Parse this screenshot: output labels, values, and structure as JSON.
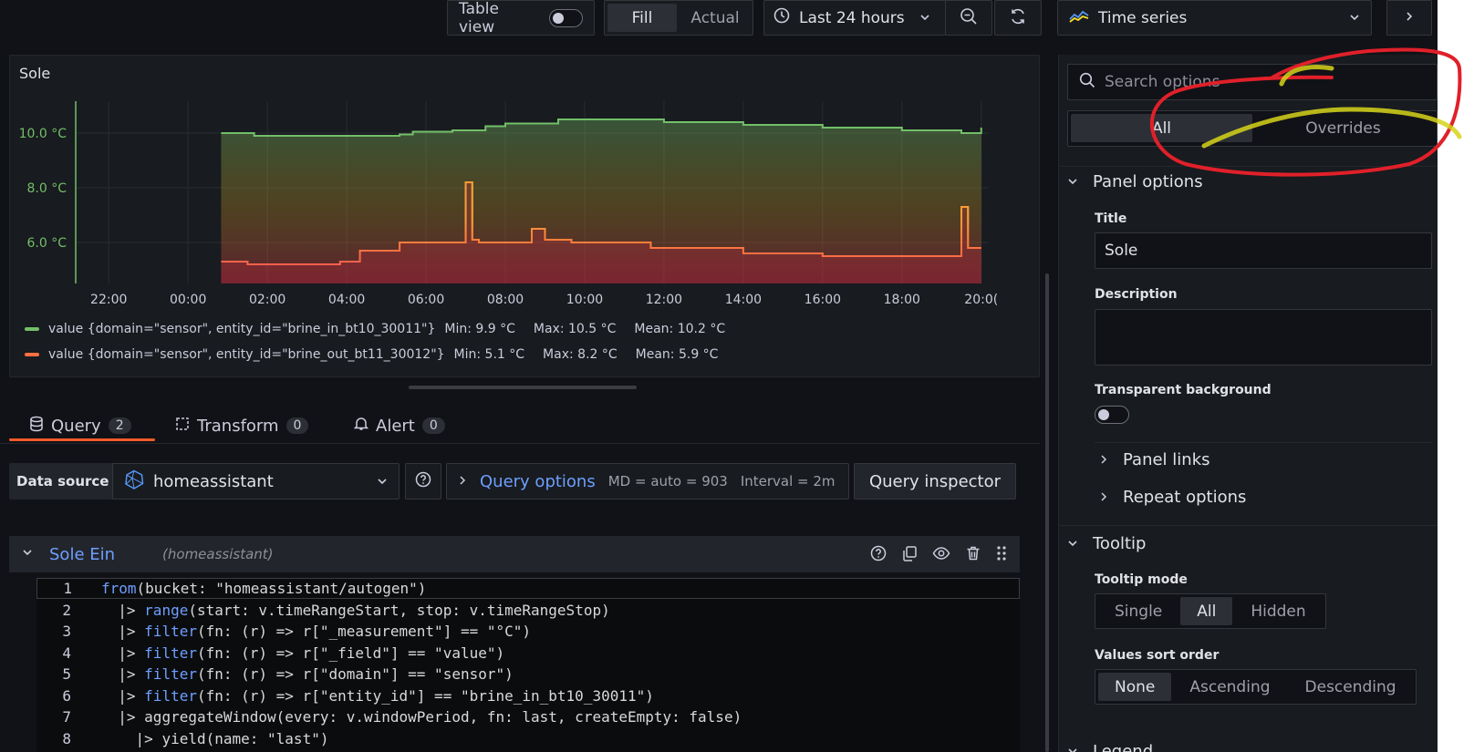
{
  "toolbar": {
    "table_view_label": "Table view",
    "fill_label": "Fill",
    "actual_label": "Actual",
    "time_range": "Last 24 hours",
    "visualization": "Time series"
  },
  "panel": {
    "title": "Sole",
    "y_ticks": [
      "10.0 °C",
      "8.0 °C",
      "6.0 °C"
    ],
    "x_ticks": [
      "22:00",
      "00:00",
      "02:00",
      "04:00",
      "06:00",
      "08:00",
      "10:00",
      "12:00",
      "14:00",
      "16:00",
      "18:00",
      "20:0("
    ]
  },
  "chart_data": {
    "type": "line",
    "unit": "°C",
    "ylim": [
      4.5,
      11.0
    ],
    "series": [
      {
        "name": "value {domain=\"sensor\", entity_id=\"brine_in_bt10_30011\"}",
        "color": "#73bf69",
        "min": "Min: 9.9 °C",
        "max": "Max: 10.5 °C",
        "mean": "Mean: 10.2 °C",
        "x": [
          "00:50",
          "01:40",
          "05:20",
          "05:40",
          "06:40",
          "07:30",
          "08:00",
          "09:20",
          "10:00",
          "12:00",
          "14:00",
          "16:00",
          "18:00",
          "19:30",
          "20:00"
        ],
        "values": [
          10.0,
          9.9,
          9.95,
          10.05,
          10.1,
          10.25,
          10.35,
          10.5,
          10.5,
          10.4,
          10.3,
          10.2,
          10.1,
          10.0,
          10.2
        ]
      },
      {
        "name": "value {domain=\"sensor\", entity_id=\"brine_out_bt11_30012\"}",
        "color": "#ff7043",
        "min": "Min: 5.1 °C",
        "max": "Max: 8.2 °C",
        "mean": "Mean: 5.9 °C",
        "x": [
          "00:50",
          "01:30",
          "03:50",
          "04:20",
          "05:20",
          "06:40",
          "07:00",
          "07:10",
          "07:20",
          "08:40",
          "09:00",
          "09:40",
          "11:40",
          "14:00",
          "16:00",
          "18:00",
          "19:20",
          "19:30",
          "19:40",
          "20:00"
        ],
        "values": [
          5.3,
          5.2,
          5.3,
          5.7,
          6.0,
          6.0,
          8.2,
          6.1,
          6.0,
          6.5,
          6.1,
          6.0,
          5.8,
          5.6,
          5.5,
          5.5,
          5.5,
          7.3,
          5.8,
          5.8
        ]
      }
    ]
  },
  "tabs": [
    {
      "label": "Query",
      "count": "2"
    },
    {
      "label": "Transform",
      "count": "0"
    },
    {
      "label": "Alert",
      "count": "0"
    }
  ],
  "query": {
    "data_source_label": "Data source",
    "data_source": "homeassistant",
    "options_label": "Query options",
    "md": "MD = auto = 903",
    "interval": "Interval = 2m",
    "inspector": "Query inspector",
    "name": "Sole Ein",
    "ds_hint": "(homeassistant)"
  },
  "code_lines": [
    {
      "n": "1",
      "pre": "",
      "kw": "from",
      "rest": "(bucket: \"homeassistant/autogen\")"
    },
    {
      "n": "2",
      "pre": "  |> ",
      "kw": "range",
      "rest": "(start: v.timeRangeStart, stop: v.timeRangeStop)"
    },
    {
      "n": "3",
      "pre": "  |> ",
      "kw": "filter",
      "rest": "(fn: (r) => r[\"_measurement\"] == \"°C\")"
    },
    {
      "n": "4",
      "pre": "  |> ",
      "kw": "filter",
      "rest": "(fn: (r) => r[\"_field\"] == \"value\")"
    },
    {
      "n": "5",
      "pre": "  |> ",
      "kw": "filter",
      "rest": "(fn: (r) => r[\"domain\"] == \"sensor\")"
    },
    {
      "n": "6",
      "pre": "  |> ",
      "kw": "filter",
      "rest": "(fn: (r) => r[\"entity_id\"] == \"brine_in_bt10_30011\")"
    },
    {
      "n": "7",
      "pre": "  |> ",
      "kw": "",
      "rest": "aggregateWindow(every: v.windowPeriod, fn: last, createEmpty: false)"
    },
    {
      "n": "8",
      "pre": "    |> ",
      "kw": "",
      "rest": "yield(name: \"last\")"
    }
  ],
  "options": {
    "search_placeholder": "Search options",
    "all_label": "All",
    "overrides_label": "Overrides",
    "panel_options": "Panel options",
    "title_label": "Title",
    "title_value": "Sole",
    "description_label": "Description",
    "transparent_label": "Transparent background",
    "panel_links": "Panel links",
    "repeat_options": "Repeat options",
    "tooltip": "Tooltip",
    "tooltip_mode_label": "Tooltip mode",
    "tooltip_modes": [
      "Single",
      "All",
      "Hidden"
    ],
    "sort_label": "Values sort order",
    "sort_modes": [
      "None",
      "Ascending",
      "Descending"
    ],
    "legend": "Legend"
  },
  "colors": {
    "accent": "#6e9fff",
    "tab_active": "#f05a28",
    "annotation_red": "#e0202a",
    "annotation_yellow": "#d6d41a"
  }
}
